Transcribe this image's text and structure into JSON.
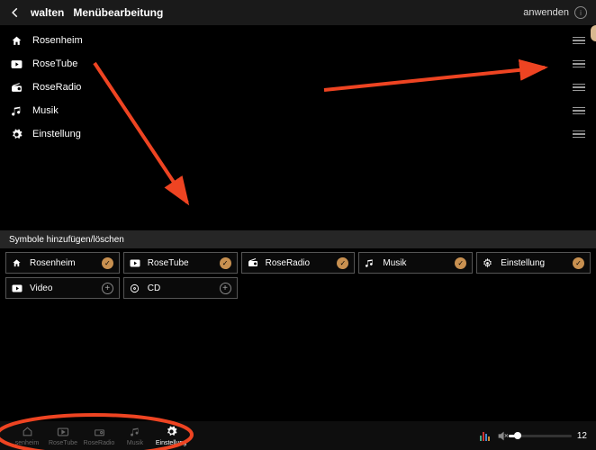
{
  "header": {
    "back_icon": "arrow-left",
    "title1": "walten",
    "title2": "Menübearbeitung",
    "apply_label": "anwenden"
  },
  "menu_items": [
    {
      "icon": "home",
      "label": "Rosenheim"
    },
    {
      "icon": "play",
      "label": "RoseTube"
    },
    {
      "icon": "radio",
      "label": "RoseRadio"
    },
    {
      "icon": "music",
      "label": "Musik"
    },
    {
      "icon": "gear",
      "label": "Einstellung"
    }
  ],
  "section_label": "Symbole hinzufügen/löschen",
  "tiles": [
    {
      "icon": "home",
      "label": "Rosenheim",
      "state": "checked"
    },
    {
      "icon": "play",
      "label": "RoseTube",
      "state": "checked"
    },
    {
      "icon": "radio",
      "label": "RoseRadio",
      "state": "checked"
    },
    {
      "icon": "music",
      "label": "Musik",
      "state": "checked"
    },
    {
      "icon": "gear",
      "label": "Einstellung",
      "state": "checked"
    },
    {
      "icon": "play",
      "label": "Video",
      "state": "add"
    },
    {
      "icon": "disc",
      "label": "CD",
      "state": "add"
    }
  ],
  "bottom_nav": [
    {
      "icon": "home",
      "label": "senheim",
      "active": false
    },
    {
      "icon": "play",
      "label": "RoseTube",
      "active": false
    },
    {
      "icon": "radio",
      "label": "RoseRadio",
      "active": false
    },
    {
      "icon": "music",
      "label": "Musik",
      "active": false
    },
    {
      "icon": "gear",
      "label": "Einstellung",
      "active": true
    }
  ],
  "volume": {
    "value": 12
  }
}
